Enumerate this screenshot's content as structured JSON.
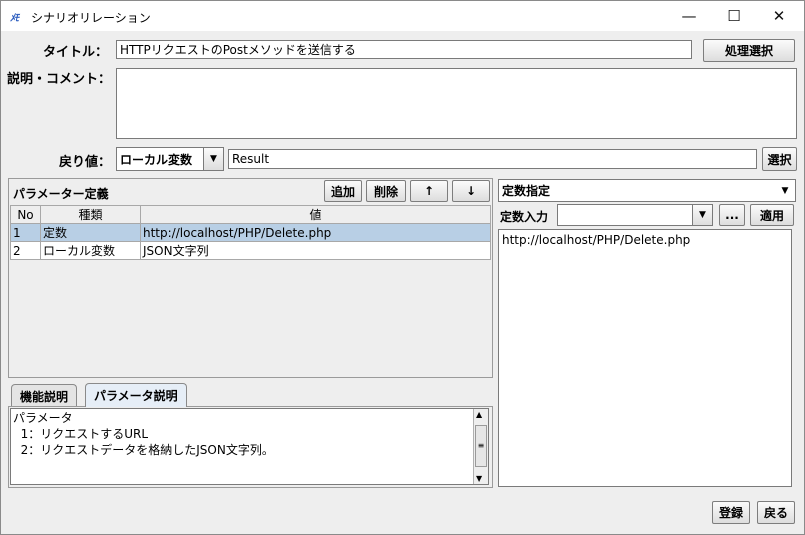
{
  "window": {
    "title": "シナリオリレーション",
    "app_icon_text": "ﾒﾓ",
    "minimize": "—",
    "maximize": "☐",
    "close": "✕"
  },
  "form": {
    "title_label": "タイトル：",
    "title_value": "HTTPリクエストのPostメソッドを送信する",
    "process_select_button": "処理選択",
    "comment_label": "説明・コメント：",
    "comment_value": "",
    "return_label": "戻り値：",
    "return_type": "ローカル変数",
    "return_value": "Result",
    "select_button": "選択"
  },
  "param_panel": {
    "title": "パラメーター定義",
    "add_button": "追加",
    "delete_button": "削除",
    "up_button": "↑",
    "down_button": "↓",
    "columns": [
      "No",
      "種類",
      "値"
    ],
    "rows": [
      {
        "no": "1",
        "kind": "定数",
        "value": "http://localhost/PHP/Delete.php"
      },
      {
        "no": "2",
        "kind": "ローカル変数",
        "value": "JSON文字列"
      }
    ]
  },
  "tabs": {
    "function_desc": "機能説明",
    "param_desc": "パラメータ説明"
  },
  "param_desc_text": "パラメータ\n  1：リクエストするURL\n  2：リクエストデータを格納したJSON文字列。",
  "right_panel": {
    "mode": "定数指定",
    "const_input_label": "定数入力",
    "const_input_value": "",
    "browse_button": "...",
    "apply_button": "適用",
    "value_text": "http://localhost/PHP/Delete.php"
  },
  "footer": {
    "register_button": "登録",
    "back_button": "戻る"
  }
}
